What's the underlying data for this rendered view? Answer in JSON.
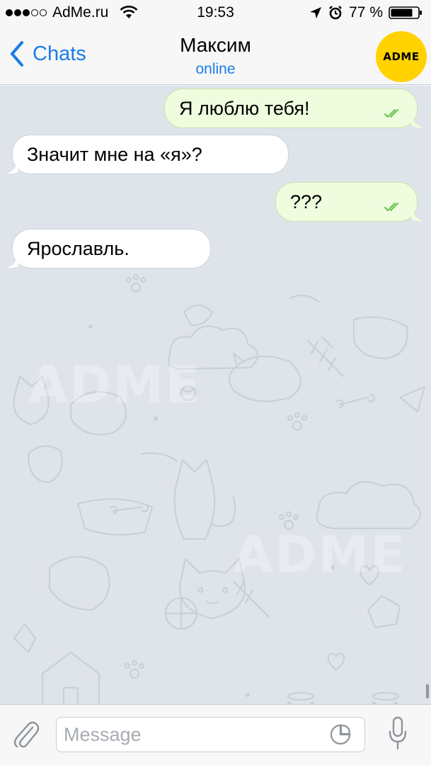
{
  "status_bar": {
    "carrier": "AdMe.ru",
    "time": "19:53",
    "battery_percent": "77 %",
    "signal_bars_filled": 3,
    "signal_bars_total": 5
  },
  "nav": {
    "back_label": "Chats",
    "title": "Максим",
    "subtitle": "online",
    "avatar_text": "ADME"
  },
  "messages": [
    {
      "direction": "outgoing",
      "text": "Я люблю тебя!",
      "status": "read"
    },
    {
      "direction": "incoming",
      "text": "Значит мне на «я»?"
    },
    {
      "direction": "outgoing",
      "text": "???",
      "status": "read"
    },
    {
      "direction": "incoming",
      "text": "Ярославль."
    }
  ],
  "input": {
    "placeholder": "Message",
    "value": ""
  },
  "watermark_text": "ADME",
  "colors": {
    "accent": "#1b7ce4",
    "outgoing_bubble": "#effdde",
    "incoming_bubble": "#ffffff",
    "read_checks": "#5fc146",
    "chat_background": "#dfe4ea",
    "avatar": "#ffd200"
  },
  "icons": {
    "back": "chevron-left-icon",
    "attach": "paperclip-icon",
    "sticker": "sticker-icon",
    "mic": "microphone-icon",
    "wifi": "wifi-icon",
    "location": "location-arrow-icon",
    "alarm": "alarm-clock-icon",
    "battery": "battery-icon",
    "read": "double-check-icon"
  }
}
